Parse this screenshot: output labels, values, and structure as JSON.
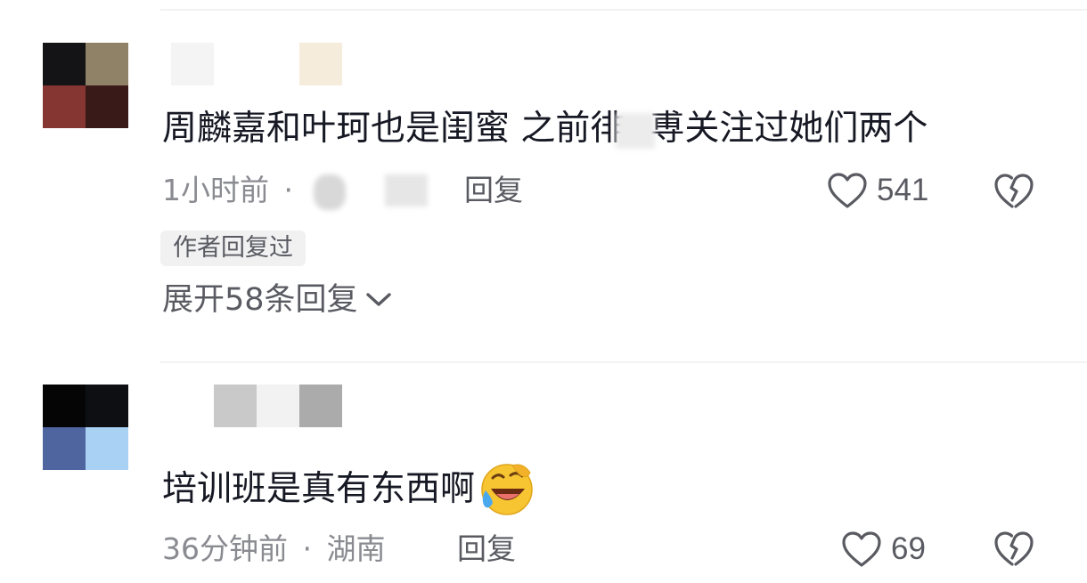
{
  "comments": [
    {
      "text_part1": "周麟嘉和叶珂也是闺蜜  之前徘",
      "text_part2": "尃关注过她们两个",
      "time": "1小时前",
      "separator": "·",
      "reply_label": "回复",
      "likes": "541",
      "author_badge": "作者回复过",
      "expand_label": "展开58条回复"
    },
    {
      "text": "培训班是真有东西啊",
      "emoji": "laughing-crying-emoji",
      "time": "36分钟前",
      "separator": "·",
      "location": "湖南",
      "reply_label": "回复",
      "likes": "69"
    }
  ],
  "colors": {
    "text_primary": "#161823",
    "text_secondary": "#8a8b91",
    "action_text": "#5a5b62",
    "divider": "#f2f2f4",
    "badge_bg": "#f1f1f2"
  },
  "icons": [
    "heart-outline-icon",
    "broken-heart-icon",
    "chevron-down-icon"
  ]
}
